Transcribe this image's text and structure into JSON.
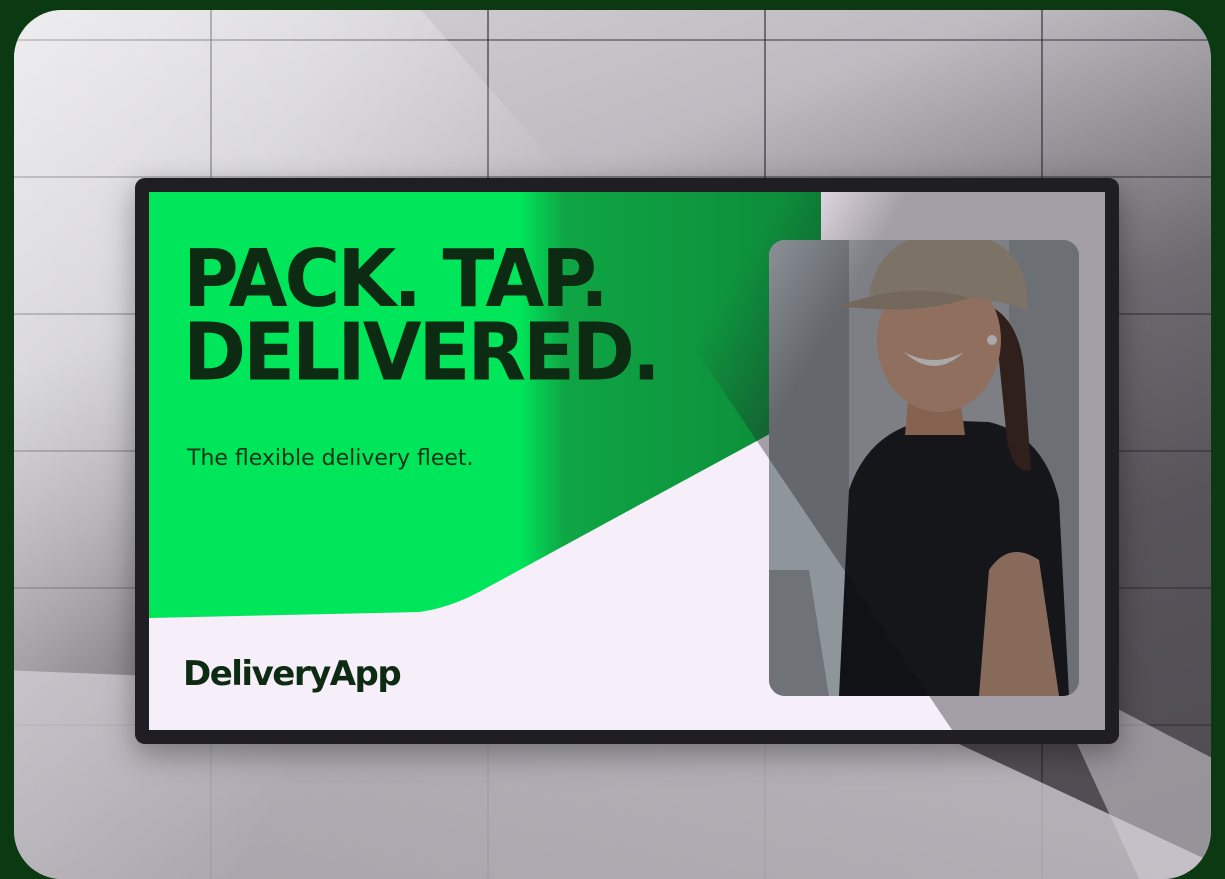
{
  "billboard": {
    "headline": "PACK. TAP.\nDELIVERED.",
    "subline": "The flexible delivery fleet.",
    "brand": "DeliveryApp",
    "photo_subject": "smiling-delivery-worker-in-cap"
  },
  "colors": {
    "background": "#0b3a12",
    "accent_green": "#00e65a",
    "text_dark": "#0d2a12",
    "screen_bg": "#f6eef8",
    "frame": "#1f1f23"
  }
}
